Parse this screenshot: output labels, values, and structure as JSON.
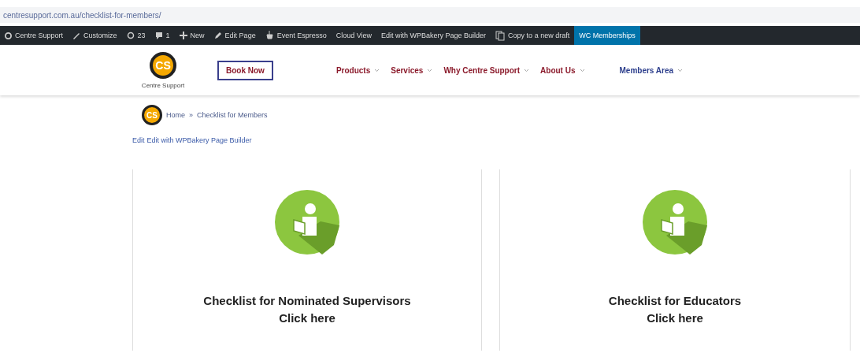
{
  "address_bar": {
    "url": "centresupport.com.au/checklist-for-members/"
  },
  "admin_bar": {
    "items": [
      {
        "kind": "site",
        "label": "Centre Support",
        "selected": false
      },
      {
        "kind": "brush",
        "label": "Customize",
        "selected": false
      },
      {
        "kind": "updates",
        "label": "23",
        "selected": false
      },
      {
        "kind": "comments",
        "label": "1",
        "selected": false
      },
      {
        "kind": "new",
        "label": "New",
        "selected": false
      },
      {
        "kind": "edit",
        "label": "Edit Page",
        "selected": false
      },
      {
        "kind": "espresso",
        "label": "Event Espresso",
        "selected": false
      },
      {
        "kind": "plain",
        "label": "Cloud View",
        "selected": false
      },
      {
        "kind": "plain",
        "label": "Edit with WPBakery Page Builder",
        "selected": false
      },
      {
        "kind": "copy",
        "label": "Copy to a new draft",
        "selected": false
      },
      {
        "kind": "plain",
        "label": "WC Memberships",
        "selected": true
      }
    ]
  },
  "header": {
    "logo_initials": "CS",
    "logo_caption": "Centre Support",
    "cta": "Book Now",
    "nav": [
      {
        "label": "Products",
        "color": "#8b1a2b"
      },
      {
        "label": "Services",
        "color": "#8b1a2b"
      },
      {
        "label": "Why Centre Support",
        "color": "#8b1a2b"
      },
      {
        "label": "About Us",
        "color": "#8b1a2b"
      },
      {
        "label": "Members Area",
        "color": "#2c3e8c"
      }
    ]
  },
  "breadcrumb": {
    "logo_initials": "CS",
    "items": [
      "Home",
      "Checklist for Members"
    ],
    "separator": "»"
  },
  "edit_links": [
    "Edit",
    "Edit with WPBakery Page Builder"
  ],
  "cards": [
    {
      "title": "Checklist for Nominated Supervisors",
      "link": "Click here"
    },
    {
      "title": "Checklist for Educators",
      "link": "Click here"
    }
  ]
}
